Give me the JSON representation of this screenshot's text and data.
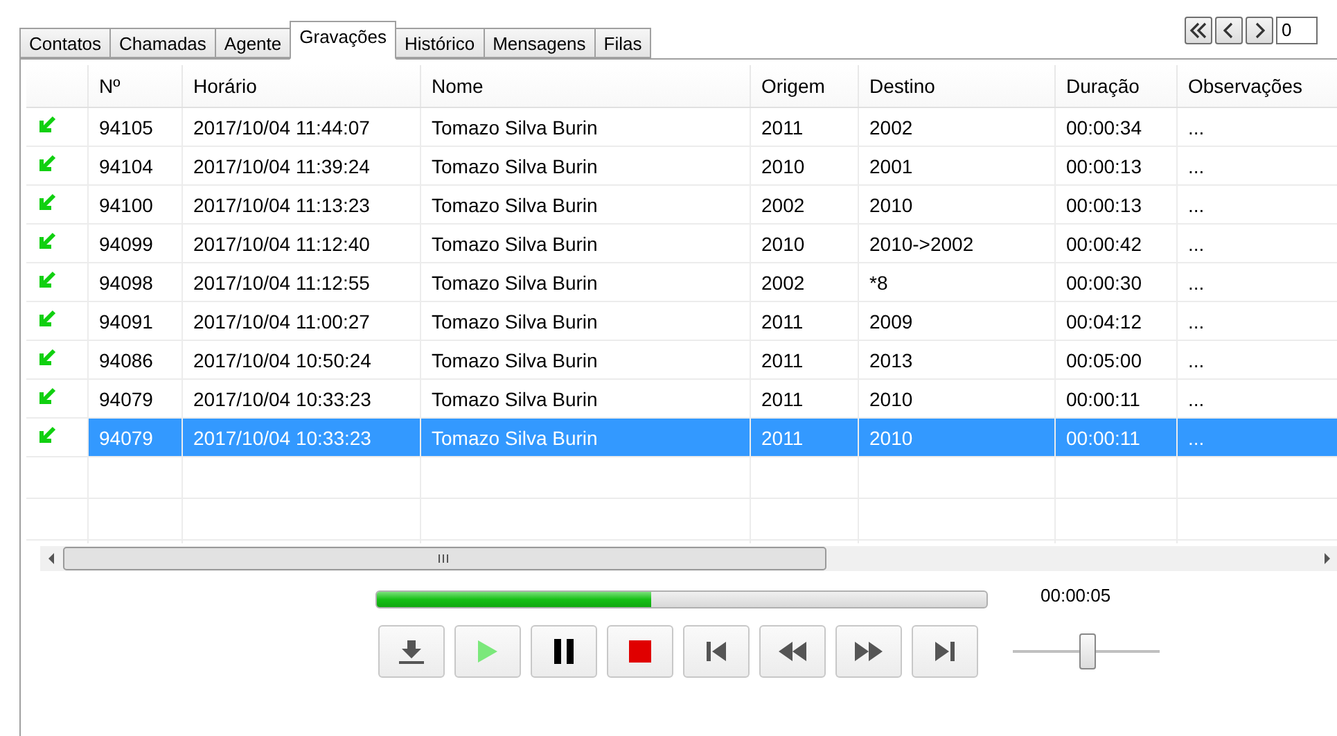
{
  "tabs": [
    {
      "label": "Contatos",
      "selected": false
    },
    {
      "label": "Chamadas",
      "selected": false
    },
    {
      "label": "Agente",
      "selected": false
    },
    {
      "label": "Gravações",
      "selected": true
    },
    {
      "label": "Histórico",
      "selected": false
    },
    {
      "label": "Mensagens",
      "selected": false
    },
    {
      "label": "Filas",
      "selected": false
    }
  ],
  "pager": {
    "buttons": [
      {
        "kind": "first"
      },
      {
        "kind": "prev"
      },
      {
        "kind": "next"
      }
    ],
    "value": "0"
  },
  "table": {
    "columns": [
      "Nº",
      "Horário",
      "Nome",
      "Origem",
      "Destino",
      "Duração",
      "Observações"
    ],
    "rows": [
      {
        "selected": false,
        "cells": [
          "94105",
          "2017/10/04 11:44:07",
          "Tomazo Silva Burin",
          "2011",
          "2002",
          "00:00:34",
          "..."
        ]
      },
      {
        "selected": false,
        "cells": [
          "94104",
          "2017/10/04 11:39:24",
          "Tomazo Silva Burin",
          "2010",
          "2001",
          "00:00:13",
          "..."
        ]
      },
      {
        "selected": false,
        "cells": [
          "94100",
          "2017/10/04 11:13:23",
          "Tomazo Silva Burin",
          "2002",
          "2010",
          "00:00:13",
          "..."
        ]
      },
      {
        "selected": false,
        "cells": [
          "94099",
          "2017/10/04 11:12:40",
          "Tomazo Silva Burin",
          "2010",
          "2010->2002",
          "00:00:42",
          "..."
        ]
      },
      {
        "selected": false,
        "cells": [
          "94098",
          "2017/10/04 11:12:55",
          "Tomazo Silva Burin",
          "2002",
          "*8",
          "00:00:30",
          "..."
        ]
      },
      {
        "selected": false,
        "cells": [
          "94091",
          "2017/10/04 11:00:27",
          "Tomazo Silva Burin",
          "2011",
          "2009",
          "00:04:12",
          "..."
        ]
      },
      {
        "selected": false,
        "cells": [
          "94086",
          "2017/10/04 10:50:24",
          "Tomazo Silva Burin",
          "2011",
          "2013",
          "00:05:00",
          "..."
        ]
      },
      {
        "selected": false,
        "cells": [
          "94079",
          "2017/10/04 10:33:23",
          "Tomazo Silva Burin",
          "2011",
          "2010",
          "00:00:11",
          "..."
        ]
      },
      {
        "selected": true,
        "cells": [
          "94079",
          "2017/10/04 10:33:23",
          "Tomazo Silva Burin",
          "2011",
          "2010",
          "00:00:11",
          "..."
        ]
      }
    ]
  },
  "player": {
    "progress": {
      "level": 0.45
    },
    "time": "00:00:05",
    "buttons": [
      {
        "kind": "download"
      },
      {
        "kind": "play"
      },
      {
        "kind": "pause"
      },
      {
        "kind": "stop"
      },
      {
        "kind": "first"
      },
      {
        "kind": "rewind"
      },
      {
        "kind": "forward"
      },
      {
        "kind": "last"
      }
    ],
    "volume": {
      "level": 0.51
    }
  }
}
